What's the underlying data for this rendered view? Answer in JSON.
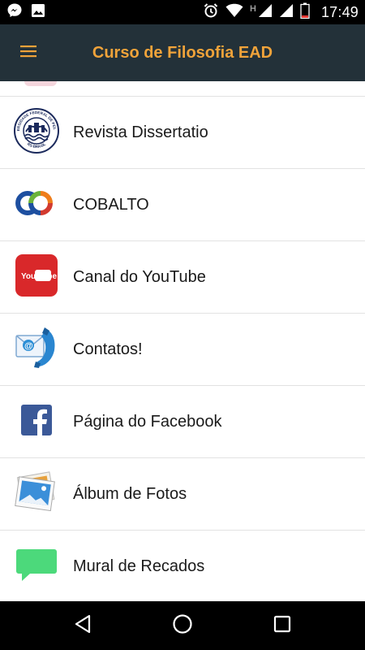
{
  "status_bar": {
    "time": "17:49",
    "network_letter": "H",
    "left_icons": [
      "messenger-icon",
      "image-icon"
    ],
    "right_icons": [
      "alarm-icon",
      "wifi-icon",
      "signal-icon",
      "battery-icon"
    ]
  },
  "app_bar": {
    "title": "Curso de Filosofia EAD",
    "menu_icon": "hamburger-menu-icon",
    "background": "#233139",
    "title_color": "#f0a33a"
  },
  "menu_items": [
    {
      "label": "Revista Dissertatio",
      "icon": "university-seal-icon"
    },
    {
      "label": "COBALTO",
      "icon": "cobalto-logo-icon"
    },
    {
      "label": "Canal do YouTube",
      "icon": "youtube-icon"
    },
    {
      "label": "Contatos!",
      "icon": "contact-phone-email-icon"
    },
    {
      "label": "Página do Facebook",
      "icon": "facebook-icon"
    },
    {
      "label": "Álbum de Fotos",
      "icon": "photo-album-icon"
    },
    {
      "label": "Mural de Recados",
      "icon": "chat-bubble-icon"
    }
  ],
  "seal_text": {
    "top": "UNIVERSIDADE FEDERAL DE PELOTAS",
    "bottom": "RS-BRASIL"
  },
  "youtube_badge": "You Tube",
  "nav_bar": [
    "back-icon",
    "home-icon",
    "recents-icon"
  ]
}
